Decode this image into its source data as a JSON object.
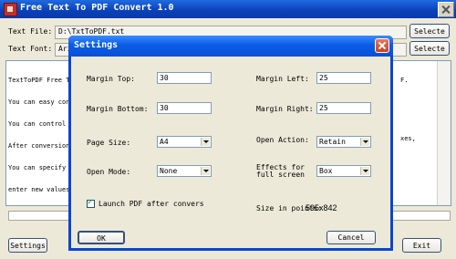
{
  "main": {
    "title": "Free Text To PDF Convert 1.0",
    "text_file_label": "Text File:",
    "text_file_value": "D:\\TxtToPDF.txt",
    "text_font_label": "Text Font:",
    "text_font_value": "Ari",
    "select_label": "Selecte",
    "memo_lines": [
      "TextToPDF Free T",
      "You can easy con",
      "You can control",
      "After conversion",
      "You can specify",
      "enter new values"
    ],
    "memo_right_lines": [
      "F.",
      "",
      "",
      "",
      "xes,",
      ""
    ],
    "settings_label": "Settings",
    "exit_label": "Exit"
  },
  "dialog": {
    "title": "Settings",
    "margin_top_label": "Margin Top:",
    "margin_top_value": "30",
    "margin_left_label": "Margin Left:",
    "margin_left_value": "25",
    "margin_bottom_label": "Margin Bottom:",
    "margin_bottom_value": "30",
    "margin_right_label": "Margin Right:",
    "margin_right_value": "25",
    "page_size_label": "Page Size:",
    "page_size_value": "A4",
    "open_action_label": "Open Action:",
    "open_action_value": "Retain",
    "open_mode_label": "Open Mode:",
    "open_mode_value": "None",
    "effects_label_1": "Effects for",
    "effects_label_2": "full screen",
    "effects_value": "Box",
    "launch_label": "Launch PDF after convers",
    "launch_checked": true,
    "size_points_label": "Size in points:",
    "size_points_value": "595x842",
    "ok_label": "OK",
    "cancel_label": "Cancel"
  }
}
